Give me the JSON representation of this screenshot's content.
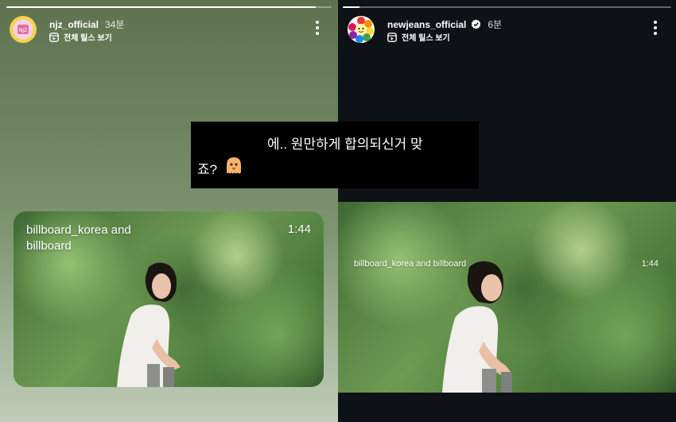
{
  "left_story": {
    "username": "njz_official",
    "time": "34분",
    "reels_label": "전체 릴스 보기",
    "progress": 0.95,
    "video": {
      "caption": "billboard_korea and\nbillboard",
      "duration": "1:44"
    }
  },
  "right_story": {
    "username": "newjeans_official",
    "time": "6분",
    "reels_label": "전체 릴스 보기",
    "progress": 0.05,
    "video": {
      "caption": "billboard_korea and billboard",
      "duration": "1:44"
    }
  },
  "comment": {
    "line1": "에.. 원만하게 합의되신거 맞",
    "line2": "죠?"
  },
  "colors": {
    "left_bg_top": "#5f7250",
    "right_bg": "#0e1115",
    "verified": "#ffffff"
  }
}
